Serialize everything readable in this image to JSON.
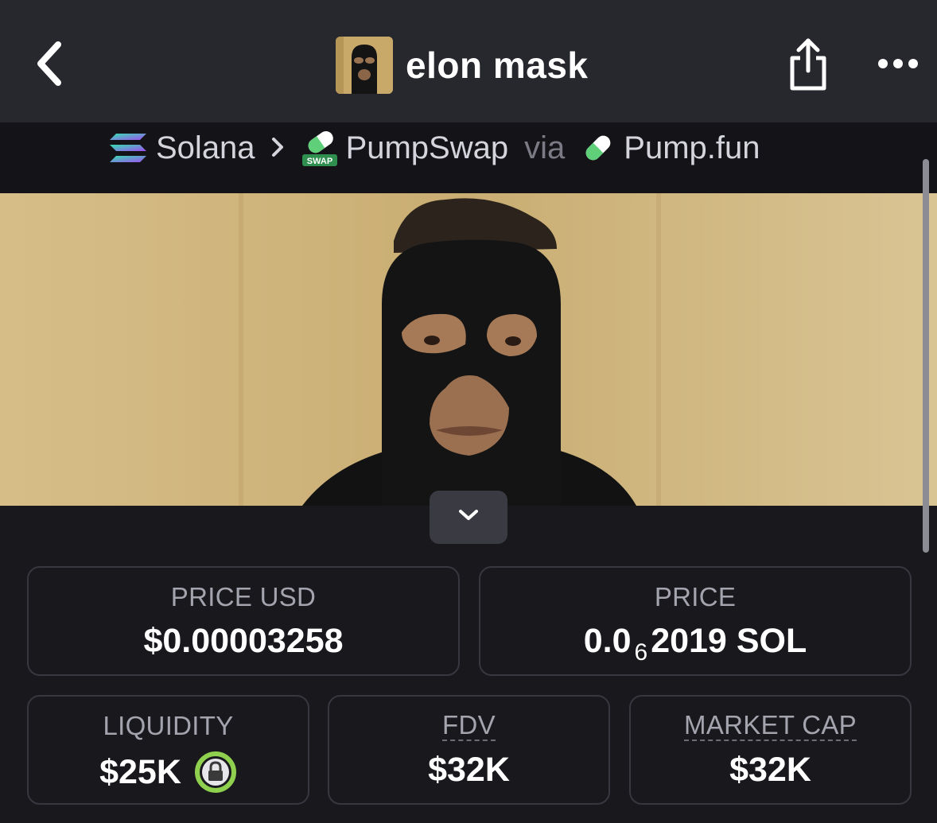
{
  "header": {
    "title": "elon mask",
    "back_icon": "chevron-left-icon",
    "share_icon": "share-icon",
    "more_icon": "more-horizontal-icon"
  },
  "breadcrumb": {
    "chain": "Solana",
    "dex": "PumpSwap",
    "dex_badge": "SWAP",
    "via": "via",
    "launchpad": "Pump.fun"
  },
  "banner": {
    "expand_icon": "chevron-down-icon"
  },
  "stats": {
    "price_usd": {
      "label": "PRICE USD",
      "value": "$0.00003258"
    },
    "price_sol": {
      "label": "PRICE",
      "prefix": "0.0",
      "zeros": "6",
      "digits": "2019",
      "unit": "SOL"
    },
    "liquidity": {
      "label": "LIQUIDITY",
      "value": "$25K",
      "icon": "lock-icon"
    },
    "fdv": {
      "label": "FDV",
      "value": "$32K"
    },
    "market_cap": {
      "label": "MARKET CAP",
      "value": "$32K"
    }
  },
  "colors": {
    "background": "#18181d",
    "header": "#27272e",
    "card_border": "#37373f",
    "lock_accent": "#8fd14f"
  }
}
